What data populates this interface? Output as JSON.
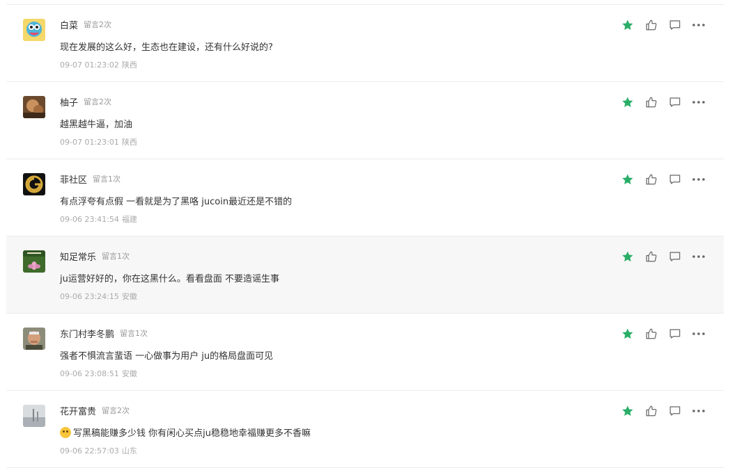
{
  "comments": [
    {
      "name": "白菜",
      "count": "留言2次",
      "content": "现在发展的这么好，生态也在建设，还有什么好说的?",
      "time": "09-07 01:23:02",
      "location": "陕西",
      "avatar": "avatar-cartoon",
      "emoji": false,
      "highlight": false
    },
    {
      "name": "柚子",
      "count": "留言2次",
      "content": "越黑越牛逼，加油",
      "time": "09-07 01:23:01",
      "location": "陕西",
      "avatar": "avatar-photo-brown",
      "emoji": false,
      "highlight": false
    },
    {
      "name": "菲社区",
      "count": "留言1次",
      "content": "有点浮夸有点假 一看就是为了黑咯 jucoin最近还是不错的",
      "time": "09-06 23:41:54",
      "location": "福建",
      "avatar": "avatar-gold-logo",
      "emoji": false,
      "highlight": false
    },
    {
      "name": "知足常乐",
      "count": "留言1次",
      "content": "ju运营好好的，你在这黑什么。看看盘面 不要造谣生事",
      "time": "09-06 23:24:15",
      "location": "安徽",
      "avatar": "avatar-lotus",
      "emoji": false,
      "highlight": true
    },
    {
      "name": "东门村李冬鹏",
      "count": "留言1次",
      "content": "强者不惧流言蜚语 一心做事为用户 ju的格局盘面可见",
      "time": "09-06 23:08:51",
      "location": "安徽",
      "avatar": "avatar-old-man",
      "emoji": false,
      "highlight": false
    },
    {
      "name": "花开富贵",
      "count": "留言2次",
      "content": "写黑稿能赚多少钱 你有闲心买点ju稳稳地幸福赚更多不香嘛",
      "time": "09-06 22:57:03",
      "location": "山东",
      "avatar": "avatar-grey-photo",
      "emoji": true,
      "highlight": false
    }
  ],
  "icons": {
    "star": "star-icon",
    "like": "thumbs-up-icon",
    "reply": "comment-icon",
    "more": "more-dots-icon"
  },
  "colors": {
    "star": "#2aae67",
    "icon": "#666666",
    "highlight_bg": "#f7f7f7"
  }
}
